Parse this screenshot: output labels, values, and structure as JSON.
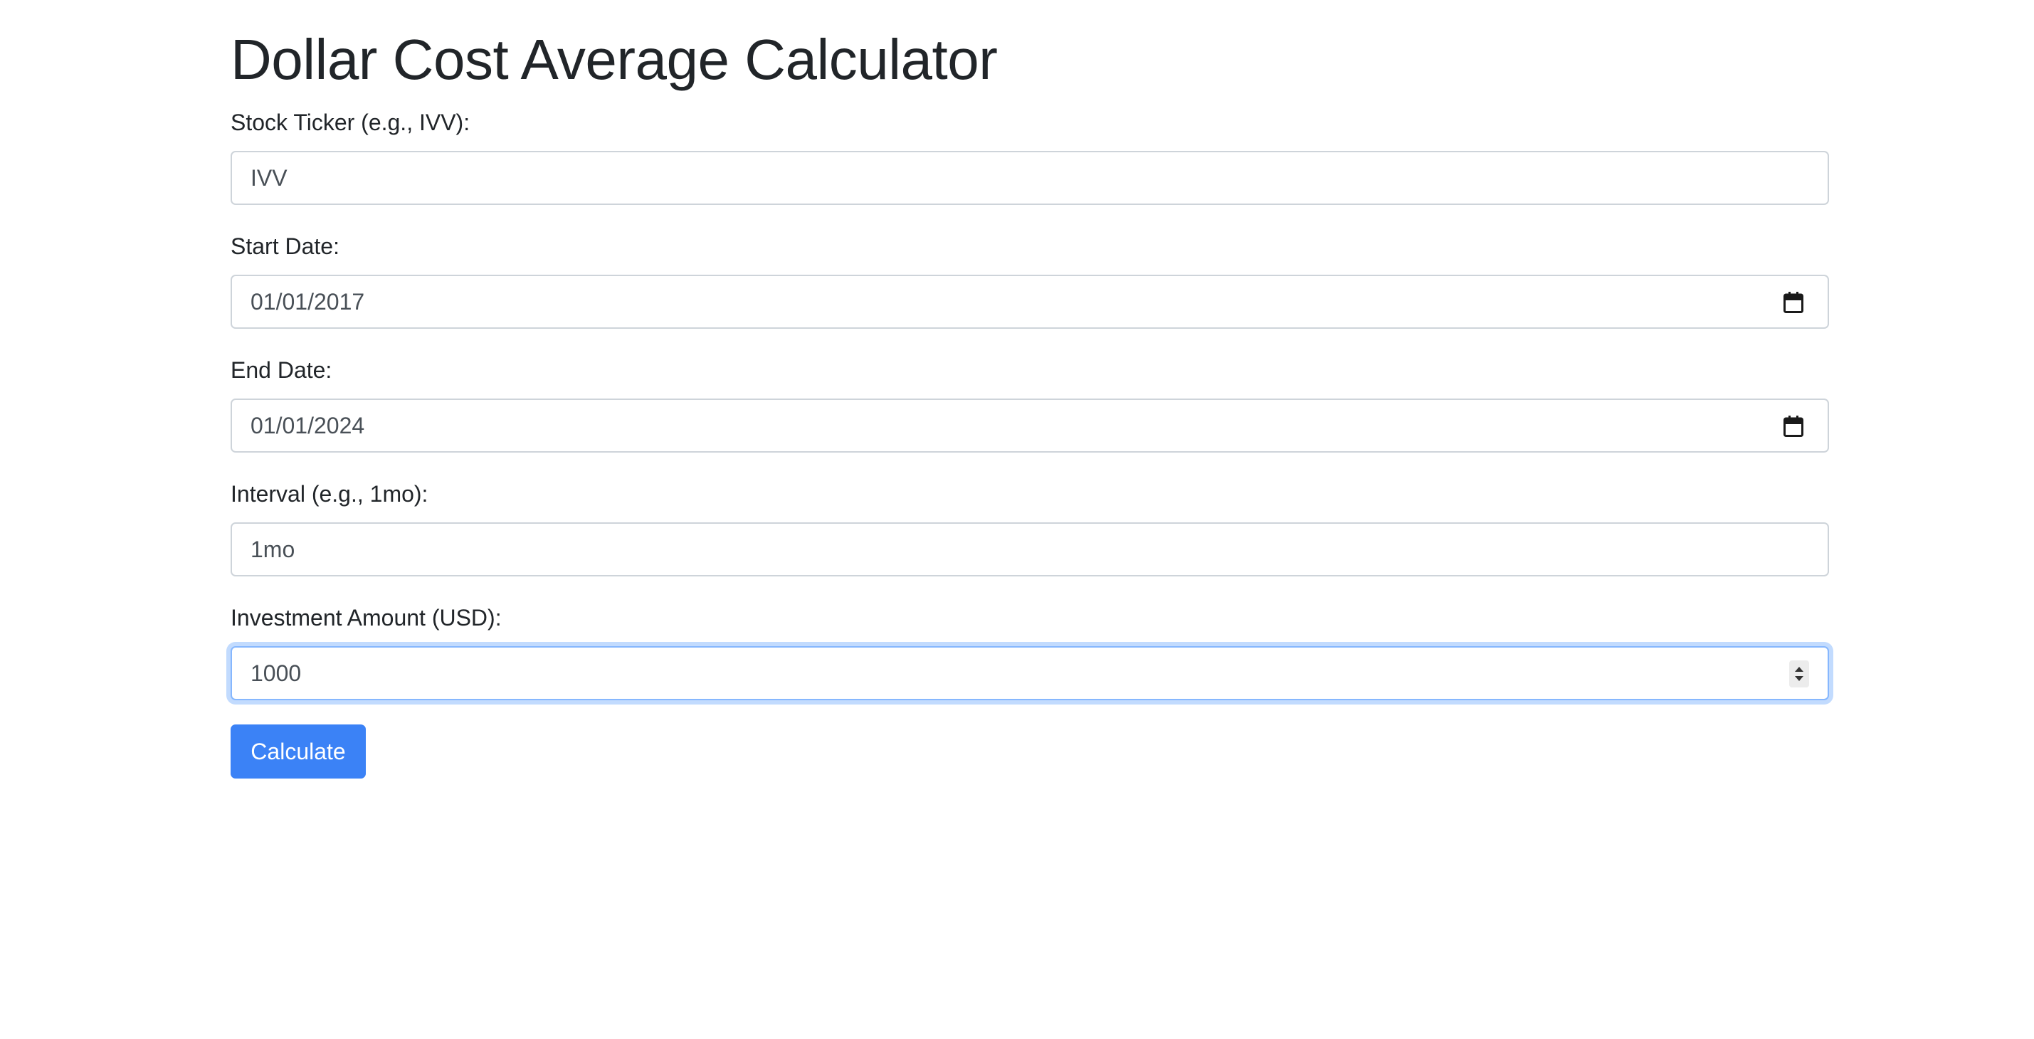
{
  "page": {
    "title": "Dollar Cost Average Calculator"
  },
  "form": {
    "ticker": {
      "label": "Stock Ticker (e.g., IVV):",
      "value": "IVV"
    },
    "start_date": {
      "label": "Start Date:",
      "value": "01/01/2017",
      "icon": "calendar-icon"
    },
    "end_date": {
      "label": "End Date:",
      "value": "01/01/2024",
      "icon": "calendar-icon"
    },
    "interval": {
      "label": "Interval (e.g., 1mo):",
      "value": "1mo"
    },
    "amount": {
      "label": "Investment Amount (USD):",
      "value": "1000",
      "focused": true
    },
    "submit_label": "Calculate"
  },
  "colors": {
    "primary": "#3b82f6",
    "text": "#212529",
    "input_border": "#ced4da",
    "focus_border": "#86b7fe"
  }
}
